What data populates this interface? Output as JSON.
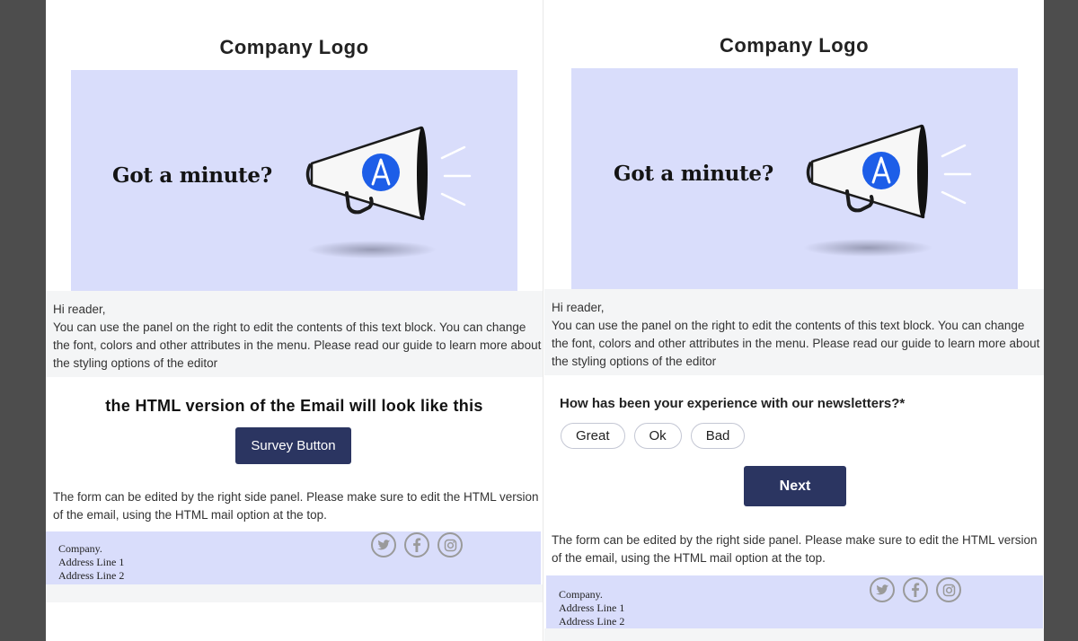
{
  "colors": {
    "backdrop": "#4d4d4d",
    "banner_bg": "#d9ddfb",
    "text_block_bg": "#f4f5f6",
    "button_bg": "#2b3561",
    "button_text": "#ffffff",
    "megaphone_badge": "#1d5ee8"
  },
  "left_preview": {
    "logo": "Company Logo",
    "banner": {
      "headline": "Got a minute?",
      "badge_letter": "A"
    },
    "text_block": {
      "greeting": "Hi reader,",
      "line1": "You can use the panel on the right to edit the contents of this text block. You can change",
      "line2": "the font, colors and other attributes in the menu. Please read our guide to learn more about",
      "line3": "the styling options of the editor"
    },
    "html_notice": "the HTML version of the Email will look like this",
    "survey_button": "Survey Button",
    "form_note": {
      "line1": "The form can be edited by the right side panel. Please make sure to edit the HTML version",
      "line2": "of the email, using the HTML mail option at the top."
    },
    "footer": {
      "company": "Company.",
      "address1": "Address Line 1",
      "address2": "Address Line 2"
    }
  },
  "right_preview": {
    "logo": "Company Logo",
    "banner": {
      "headline": "Got a minute?",
      "badge_letter": "A"
    },
    "text_block": {
      "greeting": "Hi reader,",
      "line1": "You can use the panel on the right to edit the contents of this text block. You can change",
      "line2": "the font, colors and other attributes in the menu. Please read our guide to learn more about",
      "line3": "the styling options of the editor"
    },
    "survey": {
      "question": "How has been your experience with our newsletters?*",
      "options": [
        "Great",
        "Ok",
        "Bad"
      ],
      "next": "Next"
    },
    "form_note": {
      "line1": "The form can be edited by the right side panel. Please make sure to edit the HTML version",
      "line2": "of the email, using the HTML mail option at the top."
    },
    "footer": {
      "company": "Company.",
      "address1": "Address Line 1",
      "address2": "Address Line 2"
    }
  },
  "social_icons": [
    "twitter-icon",
    "facebook-icon",
    "instagram-icon"
  ]
}
